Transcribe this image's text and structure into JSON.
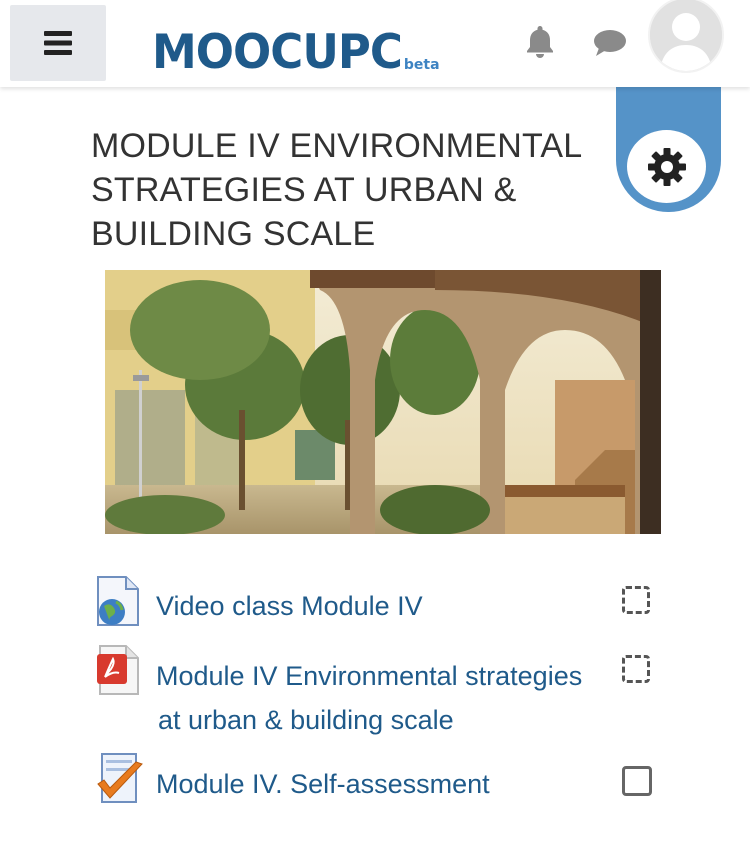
{
  "header": {
    "logo_main": "MOOCUPC",
    "logo_beta": "beta",
    "icons": {
      "menu": "hamburger-menu-icon",
      "notifications": "bell-icon",
      "messages": "chat-bubble-icon",
      "user": "user-avatar"
    }
  },
  "settings": {
    "icon": "gear-icon",
    "color": "#5593c8"
  },
  "page": {
    "title": "MODULE IV ENVIRONMENTAL STRATEGIES AT URBAN & BUILDING SCALE"
  },
  "activities": [
    {
      "icon": "url-globe-icon",
      "line1": "Video class Module IV",
      "line2": "",
      "completion": "manual-dashed"
    },
    {
      "icon": "pdf-file-icon",
      "line1": "Module IV Environmental strategies",
      "line2": "at urban & building scale",
      "completion": "manual-dashed"
    },
    {
      "icon": "quiz-check-icon",
      "line1": "Module IV. Self-assessment",
      "line2": "",
      "completion": "manual-solid"
    }
  ],
  "colors": {
    "link": "#1f5a8a",
    "brand": "#1f5a8a",
    "accent": "#5593c8"
  }
}
